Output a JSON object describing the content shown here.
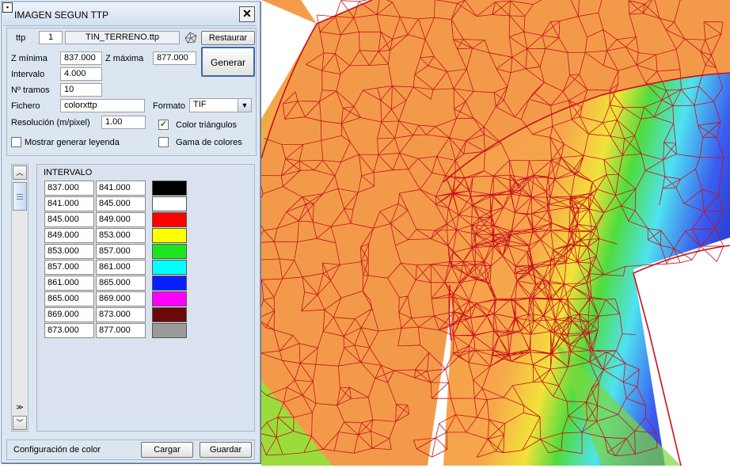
{
  "window": {
    "title": "IMAGEN SEGUN TTP",
    "pin_icon": "pin-icon",
    "close_symbol": "✕"
  },
  "ttp": {
    "label": "ttp",
    "number": "1",
    "file": "TIN_TERRENO.ttp",
    "tin_icon": "tin-mesh-icon",
    "restore_label": "Restaurar"
  },
  "params": {
    "zmin_label": "Z mínima",
    "zmin_value": "837.000",
    "zmax_label": "Z máxima",
    "zmax_value": "877.000",
    "generate_label": "Generar",
    "interval_label": "Intervalo",
    "interval_value": "4.000",
    "tramos_label": "Nº tramos",
    "tramos_value": "10",
    "file_label": "Fichero",
    "file_value": "colorxttp",
    "format_label": "Formato",
    "format_value": "TIF",
    "resolution_label": "Resolución (m/pixel)",
    "resolution_value": "1.00",
    "color_triangles_label": "Color triángulos",
    "color_triangles_checked": true,
    "legend_label": "Mostrar generar leyenda",
    "legend_checked": false,
    "gamut_label": "Gama de colores",
    "gamut_checked": false
  },
  "intervals": {
    "header": "INTERVALO",
    "rows": [
      {
        "from": "837.000",
        "to": "841.000",
        "color": "#000000"
      },
      {
        "from": "841.000",
        "to": "845.000",
        "color": "#ffffff"
      },
      {
        "from": "845.000",
        "to": "849.000",
        "color": "#ff0000"
      },
      {
        "from": "849.000",
        "to": "853.000",
        "color": "#ffff00"
      },
      {
        "from": "853.000",
        "to": "857.000",
        "color": "#1ee61e"
      },
      {
        "from": "857.000",
        "to": "861.000",
        "color": "#00ffff"
      },
      {
        "from": "861.000",
        "to": "865.000",
        "color": "#0a1eff"
      },
      {
        "from": "865.000",
        "to": "869.000",
        "color": "#ff00ff"
      },
      {
        "from": "869.000",
        "to": "873.000",
        "color": "#6b0a0a"
      },
      {
        "from": "873.000",
        "to": "877.000",
        "color": "#9a9a9a"
      }
    ]
  },
  "scrollbar": {
    "up_symbol": "︿",
    "down_symbol": "﹀",
    "fast_down_symbol": "≫"
  },
  "footer": {
    "status": "Configuración de color",
    "load_label": "Cargar",
    "save_label": "Guardar"
  },
  "viewport": {
    "wire_color": "#c8101c",
    "colors": {
      "orange": "#f39a4a",
      "yellow": "#f2e23a",
      "green": "#4fdc3c",
      "cyan": "#4fe3f0",
      "blue": "#3b5cf0"
    }
  }
}
